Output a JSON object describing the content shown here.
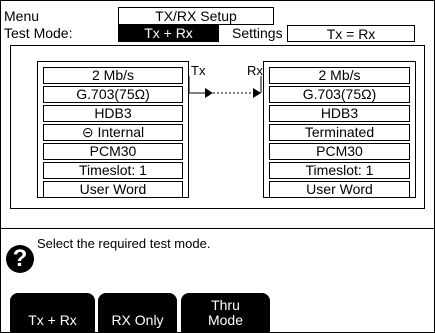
{
  "header": {
    "menu_label": "Menu",
    "menu_title": "TX/RX Setup",
    "test_mode_label": "Test Mode:",
    "test_mode_value": "Tx + Rx",
    "settings_label": "Settings",
    "settings_value": "Tx = Rx"
  },
  "diagram": {
    "tx_label": "Tx",
    "rx_label": "Rx",
    "tx_column": [
      "2 Mb/s",
      "G.703(75Ω)",
      "HDB3",
      "⊝ Internal",
      "PCM30",
      "Timeslot: 1",
      "User Word"
    ],
    "rx_column": [
      "2 Mb/s",
      "G.703(75Ω)",
      "HDB3",
      "Terminated",
      "PCM30",
      "Timeslot: 1",
      "User Word"
    ]
  },
  "help": {
    "icon": "question-icon",
    "text": "Select the required test mode."
  },
  "softkeys": [
    "Tx + Rx",
    "RX Only",
    "Thru\nMode"
  ]
}
